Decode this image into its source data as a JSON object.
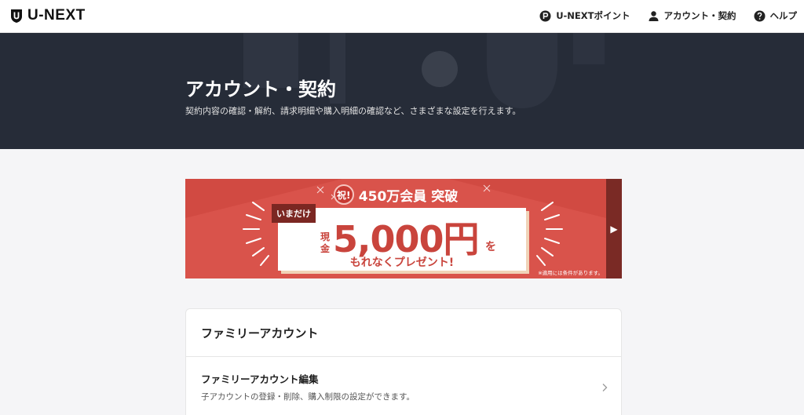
{
  "header": {
    "logo_text": "U-NEXT",
    "nav": [
      {
        "label": "U-NEXTポイント",
        "icon": "points-icon"
      },
      {
        "label": "アカウント・契約",
        "icon": "user-icon"
      },
      {
        "label": "ヘルプ",
        "icon": "help-icon"
      }
    ]
  },
  "hero": {
    "title": "アカウント・契約",
    "subtitle": "契約内容の確認・解約、請求明細や購入明細の確認など、さまざまな設定を行えます。"
  },
  "banner": {
    "badge": "祝!",
    "headline": "450万会員 突破",
    "tag": "いまだけ",
    "cash_label": "現金",
    "amount": "5,000円",
    "particle": "を",
    "present": "もれなくプレゼント!",
    "note": "※適用には条件があります。",
    "arrow": "▶",
    "colors": {
      "background": "#d9534b",
      "accent": "#c9443c",
      "dark": "#7b2722"
    }
  },
  "family": {
    "title": "ファミリーアカウント",
    "rows": [
      {
        "title": "ファミリーアカウント編集",
        "description": "子アカウントの登録・削除、購入制限の設定ができます。"
      }
    ]
  },
  "colors": {
    "hero_bg": "#262c38",
    "page_bg": "#f5f5f7"
  }
}
